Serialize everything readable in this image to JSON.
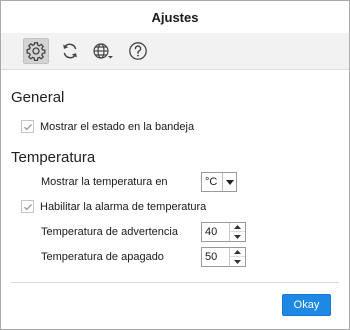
{
  "window": {
    "title": "Ajustes"
  },
  "toolbar": {
    "items": [
      {
        "icon": "gear-icon",
        "selected": true
      },
      {
        "icon": "refresh-icon",
        "selected": false
      },
      {
        "icon": "globe-icon",
        "selected": false
      },
      {
        "icon": "help-icon",
        "selected": false
      }
    ]
  },
  "general": {
    "title": "General",
    "show_tray_status": {
      "label": "Mostrar el estado en la bandeja",
      "checked": true
    }
  },
  "temperature": {
    "title": "Temperatura",
    "unit_label": "Mostrar la temperatura en",
    "unit_value": "°C",
    "alarm": {
      "label": "Habilitar la alarma de temperatura",
      "checked": true
    },
    "warning_label": "Temperatura de advertencia",
    "warning_value": "40",
    "shutdown_label": "Temperatura de apagado",
    "shutdown_value": "50"
  },
  "footer": {
    "ok_label": "Okay"
  },
  "colors": {
    "accent": "#1e88e5",
    "check": "#9e9e9e"
  }
}
